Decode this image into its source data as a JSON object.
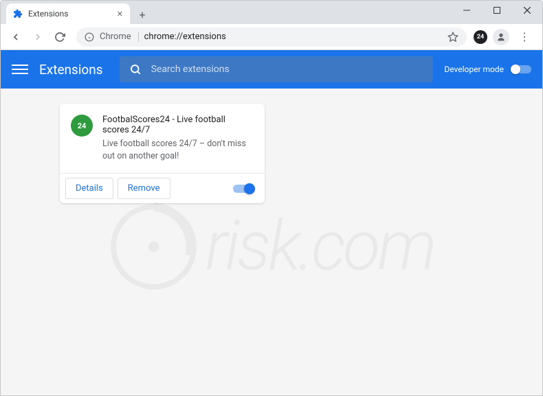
{
  "window": {
    "tab_title": "Extensions",
    "tab_icon": "puzzle-icon"
  },
  "omnibox": {
    "security_label": "Chrome",
    "url": "chrome://extensions",
    "badge_text": "24"
  },
  "header": {
    "title": "Extensions",
    "search_placeholder": "Search extensions",
    "dev_mode_label": "Developer mode"
  },
  "extension": {
    "icon_text": "24",
    "name": "FootbalScores24 - Live football scores 24/7",
    "description": "Live football scores 24/7 – don't miss out on another goal!",
    "details_label": "Details",
    "remove_label": "Remove",
    "enabled": true
  },
  "watermark": {
    "text": "risk.com"
  }
}
